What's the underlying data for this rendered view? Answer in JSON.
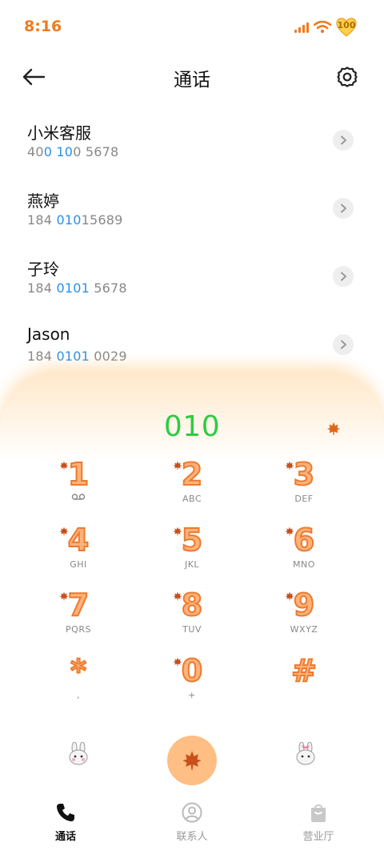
{
  "status": {
    "time": "8:16",
    "battery": "100",
    "icons": [
      "signal-icon",
      "wifi-icon",
      "battery-icon"
    ],
    "accent": "#f07b1e"
  },
  "header": {
    "title": "通话",
    "back_icon": "back-arrow-icon",
    "settings_icon": "gear-icon"
  },
  "contacts": [
    {
      "name": "小米客服",
      "number_parts": [
        "40",
        "0 10",
        "0 5678"
      ]
    },
    {
      "name": "燕婷",
      "number_parts": [
        "184 ",
        "010",
        "15689"
      ]
    },
    {
      "name": "子玲",
      "number_parts": [
        "184 ",
        "0101",
        " 5678"
      ]
    },
    {
      "name": "Jason",
      "number_parts": [
        "184 ",
        "0101",
        " 0029"
      ]
    }
  ],
  "dialer": {
    "number": "010",
    "number_color": "#2ecc40",
    "keys": [
      {
        "digit": "1",
        "letters": ""
      },
      {
        "digit": "2",
        "letters": "ABC"
      },
      {
        "digit": "3",
        "letters": "DEF"
      },
      {
        "digit": "4",
        "letters": "GHI"
      },
      {
        "digit": "5",
        "letters": "JKL"
      },
      {
        "digit": "6",
        "letters": "MNO"
      },
      {
        "digit": "7",
        "letters": "PQRS"
      },
      {
        "digit": "8",
        "letters": "TUV"
      },
      {
        "digit": "9",
        "letters": "WXYZ"
      },
      {
        "digit": "*",
        "letters": ","
      },
      {
        "digit": "0",
        "letters": "+"
      },
      {
        "digit": "#",
        "letters": ""
      }
    ],
    "call_icon": "maple-leaf-icon",
    "call_color": "#ffbe84"
  },
  "nav": {
    "items": [
      {
        "label": "通话",
        "icon": "phone-icon",
        "active": true
      },
      {
        "label": "联系人",
        "icon": "person-icon",
        "active": false
      },
      {
        "label": "营业厅",
        "icon": "shopping-bag-icon",
        "active": false
      }
    ]
  }
}
